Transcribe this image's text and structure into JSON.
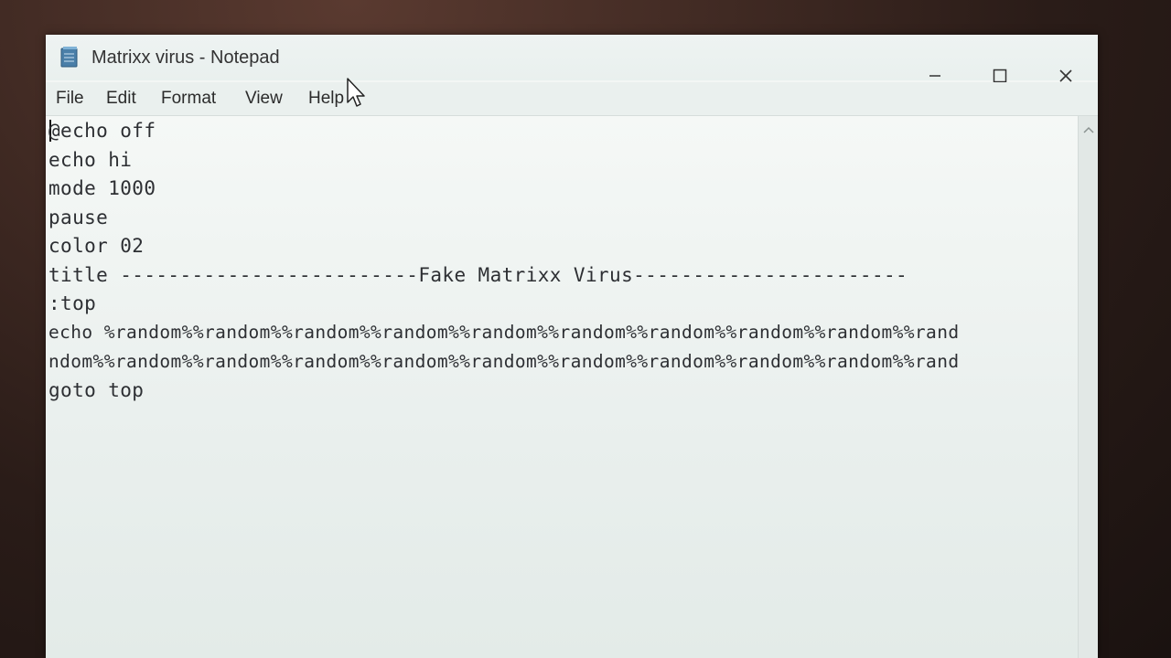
{
  "window": {
    "title": "Matrixx virus - Notepad",
    "icon": "notepad-icon"
  },
  "controls": {
    "minimize": "minimize-icon",
    "maximize": "maximize-icon",
    "close": "close-icon"
  },
  "menu": {
    "items": [
      {
        "label": "File"
      },
      {
        "label": "Edit"
      },
      {
        "label": "Format"
      },
      {
        "label": "View"
      },
      {
        "label": "Help"
      }
    ]
  },
  "editor": {
    "lines": [
      "@echo off",
      "echo hi",
      "mode 1000",
      "pause",
      "color 02",
      "title -------------------------Fake Matrixx Virus-----------------------",
      ":top",
      "echo %random%%random%%random%%random%%random%%random%%random%%random%%random%%rand",
      "ndom%%random%%random%%random%%random%%random%%random%%random%%random%%random%%rand",
      "goto top"
    ]
  },
  "colors": {
    "window_bg": "#f3f6f4",
    "text": "#2d2f33",
    "title_text": "#333333"
  }
}
